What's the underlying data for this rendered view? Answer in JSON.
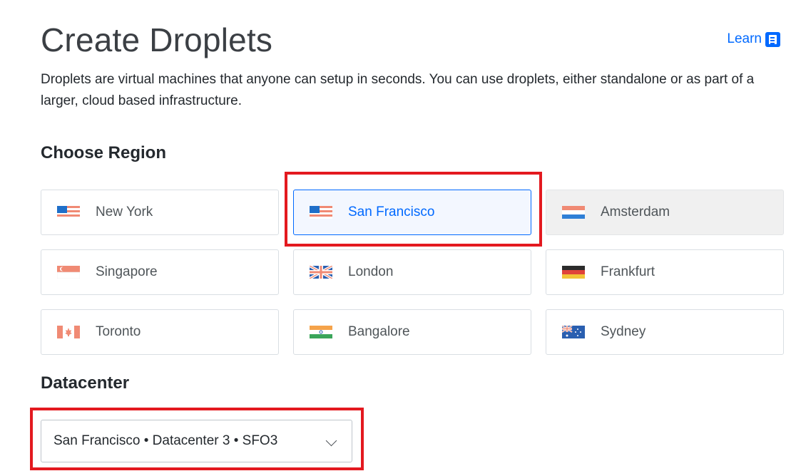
{
  "header": {
    "title": "Create Droplets",
    "learn_label": "Learn"
  },
  "description": "Droplets are virtual machines that anyone can setup in seconds. You can use droplets, either standalone or as part of a larger, cloud based infrastructure.",
  "region": {
    "heading": "Choose Region",
    "options": [
      {
        "label": "New York",
        "flag": "us-flag-icon",
        "state": "default"
      },
      {
        "label": "San Francisco",
        "flag": "us-flag-icon",
        "state": "selected"
      },
      {
        "label": "Amsterdam",
        "flag": "netherlands-flag-icon",
        "state": "disabled"
      },
      {
        "label": "Singapore",
        "flag": "singapore-flag-icon",
        "state": "default"
      },
      {
        "label": "London",
        "flag": "uk-flag-icon",
        "state": "default"
      },
      {
        "label": "Frankfurt",
        "flag": "germany-flag-icon",
        "state": "default"
      },
      {
        "label": "Toronto",
        "flag": "canada-flag-icon",
        "state": "default"
      },
      {
        "label": "Bangalore",
        "flag": "india-flag-icon",
        "state": "default"
      },
      {
        "label": "Sydney",
        "flag": "australia-flag-icon",
        "state": "default"
      }
    ]
  },
  "datacenter": {
    "heading": "Datacenter",
    "selected": "San Francisco • Datacenter 3 • SFO3"
  },
  "colors": {
    "accent": "#0069ff",
    "highlight": "#e3191f"
  }
}
